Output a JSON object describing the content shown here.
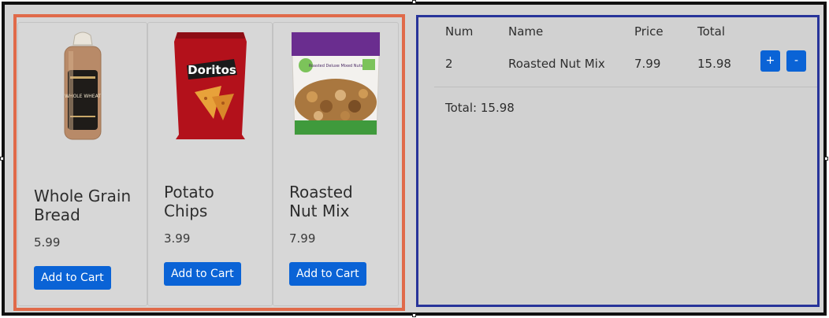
{
  "products": [
    {
      "title": "Whole Grain Bread",
      "price": "5.99",
      "button": "Add to Cart",
      "image_icon": "bread-icon"
    },
    {
      "title": "Potato Chips",
      "price": "3.99",
      "button": "Add to Cart",
      "image_icon": "chips-bag-icon"
    },
    {
      "title": "Roasted Nut Mix",
      "price": "7.99",
      "button": "Add to Cart",
      "image_icon": "nut-mix-bag-icon"
    }
  ],
  "cart": {
    "headers": {
      "num": "Num",
      "name": "Name",
      "price": "Price",
      "total": "Total"
    },
    "rows": [
      {
        "num": "2",
        "name": "Roasted Nut Mix",
        "price": "7.99",
        "total": "15.98",
        "plus_label": "+",
        "minus_label": "-"
      }
    ],
    "total_text": "Total: 15.98"
  },
  "colors": {
    "products_border": "#e06a4a",
    "cart_border": "#28349a",
    "button": "#0a63d6",
    "background": "#d4d4d4"
  },
  "image_text": {
    "bread_label": "WHOLE WHEAT",
    "chips_brand": "Doritos",
    "nut_label": "Roasted Deluxe Mixed Nuts"
  }
}
